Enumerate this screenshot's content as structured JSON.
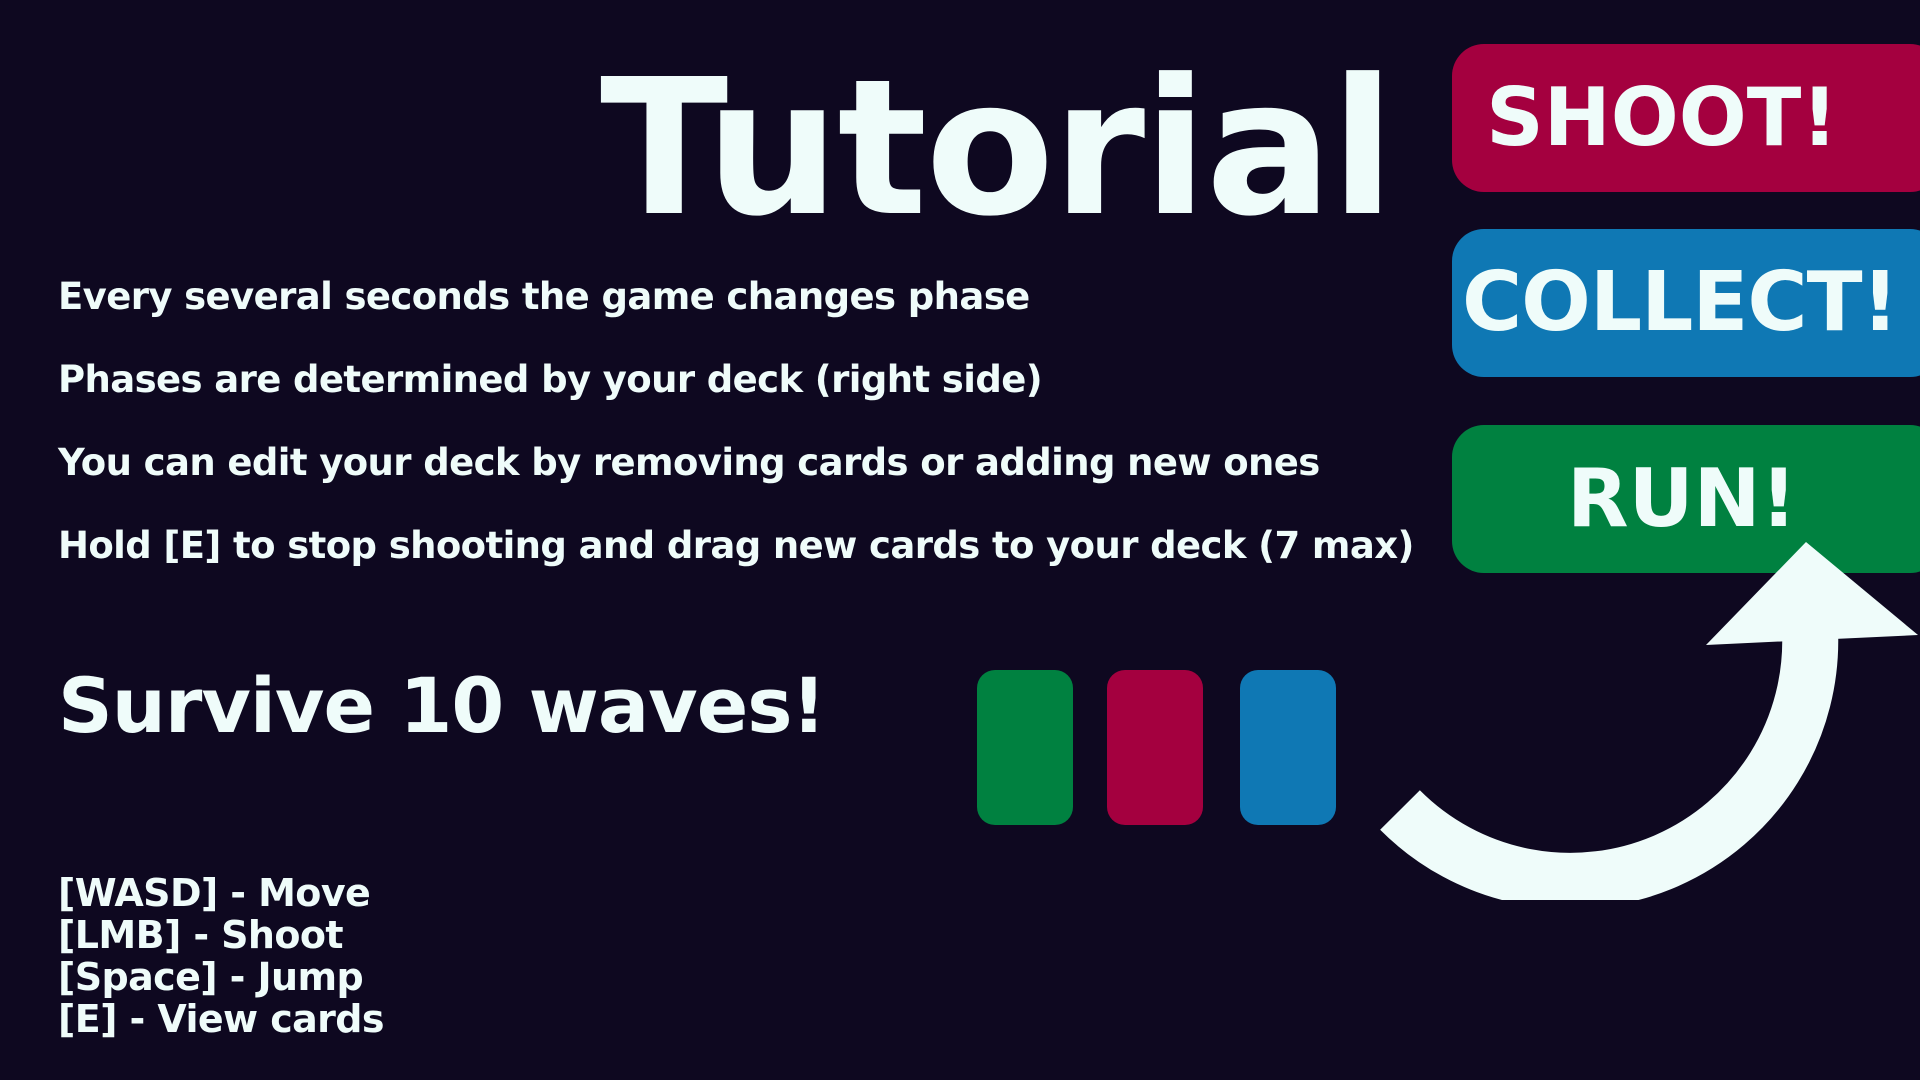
{
  "title": "Tutorial",
  "instructions": [
    "Every several seconds the game changes phase",
    "Phases are determined by your deck (right side)",
    "You can edit your deck by removing cards or adding new ones",
    "Hold [E] to stop shooting and drag new cards to your deck (7 max)"
  ],
  "goal": "Survive 10 waves!",
  "controls": [
    "[WASD] - Move",
    "[LMB] - Shoot",
    "[Space] - Jump",
    "[E] - View cards"
  ],
  "phases": [
    {
      "label": "SHOOT!",
      "color": "#a4003f"
    },
    {
      "label": "COLLECT!",
      "color": "#0f78b4"
    },
    {
      "label": "RUN!",
      "color": "#008140"
    }
  ],
  "deck_cards": [
    {
      "phase": "RUN!",
      "color": "#008140"
    },
    {
      "phase": "SHOOT!",
      "color": "#a4003f"
    },
    {
      "phase": "COLLECT!",
      "color": "#0f78b4"
    }
  ],
  "colors": {
    "background": "#0e0820",
    "text": "#effcfa",
    "arrow": "#effcfa"
  },
  "icons": {
    "arrow": "curved-arrow-icon"
  }
}
